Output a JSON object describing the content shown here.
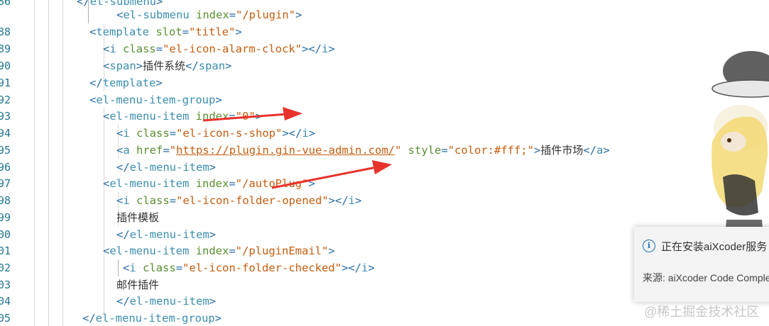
{
  "editor": {
    "line_numbers": [
      "86",
      "88",
      "89",
      "90",
      "91",
      "92",
      "93",
      "94",
      "95",
      "96",
      "97",
      "98",
      "99",
      "00",
      "01",
      "02",
      "03",
      "04",
      "05"
    ],
    "lines": {
      "l0": {
        "t1": "</",
        "t2": "el-submenu",
        "t3": ">"
      },
      "l1": {
        "t1": "<",
        "t2": "el-submenu",
        "a1": " index",
        "eq": "=",
        "v1": "\"/plugin\"",
        "t3": ">"
      },
      "l2": {
        "t1": "<",
        "t2": "template",
        "a1": " slot",
        "eq": "=",
        "v1": "\"title\"",
        "t3": ">"
      },
      "l3": {
        "t1": "<",
        "t2": "i",
        "a1": " class",
        "eq": "=",
        "v1": "\"el-icon-alarm-clock\"",
        "t3": "></",
        "t4": "i",
        "t5": ">"
      },
      "l4": {
        "t1": "<",
        "t2": "span",
        "t3": ">",
        "text": "插件系统",
        "t4": "</",
        "t5": "span",
        "t6": ">"
      },
      "l5": {
        "t1": "</",
        "t2": "template",
        "t3": ">"
      },
      "l6": {
        "t1": "<",
        "t2": "el-menu-item-group",
        "t3": ">"
      },
      "l7": {
        "t1": "<",
        "t2": "el-menu-item",
        "a1": " index",
        "eq": "=",
        "v1": "\"0\"",
        "t3": ">"
      },
      "l8": {
        "t1": "<",
        "t2": "i",
        "a1": " class",
        "eq": "=",
        "v1": "\"el-icon-s-shop\"",
        "t3": "></",
        "t4": "i",
        "t5": ">"
      },
      "l9": {
        "t1": "<",
        "t2": "a",
        "a1": " href",
        "eq": "=",
        "q1": "\"",
        "url": "https://plugin.gin-vue-admin.com/",
        "q2": "\"",
        "a2": " style",
        "eq2": "=",
        "v2": "\"color:#fff;\"",
        "t3": ">",
        "text": "插件市场",
        "t4": "</",
        "t5": "a",
        "t6": ">"
      },
      "l10": {
        "t1": "</",
        "t2": "el-menu-item",
        "t3": ">"
      },
      "l11": {
        "t1": "<",
        "t2": "el-menu-item",
        "a1": " index",
        "eq": "=",
        "v1": "\"/autoPlug\"",
        "t3": ">"
      },
      "l12": {
        "t1": "<",
        "t2": "i",
        "a1": " class",
        "eq": "=",
        "v1": "\"el-icon-folder-opened\"",
        "t3": "></",
        "t4": "i",
        "t5": ">"
      },
      "l13": {
        "text": "插件模板"
      },
      "l14": {
        "t1": "</",
        "t2": "el-menu-item",
        "t3": ">"
      },
      "l15": {
        "t1": "<",
        "t2": "el-menu-item",
        "a1": " index",
        "eq": "=",
        "v1": "\"/pluginEmail\"",
        "t3": ">"
      },
      "l16": {
        "t1": "<",
        "t2": "i",
        "a1": " class",
        "eq": "=",
        "v1": "\"el-icon-folder-checked\"",
        "t3": "></",
        "t4": "i",
        "t5": ">"
      },
      "l17": {
        "text": "邮件插件"
      },
      "l18": {
        "t1": "</",
        "t2": "el-menu-item",
        "t3": ">"
      },
      "l19": {
        "t1": "</",
        "t2": "el-menu-item-group",
        "t3": ">"
      }
    }
  },
  "notification": {
    "icon": "info-icon",
    "icon_glyph": "i",
    "message": "正在安装aiXcoder服务",
    "source": "来源: aiXcoder Code Completer"
  },
  "watermark": "@稀土掘金技术社区",
  "colors": {
    "line_number": "#237893",
    "tag": "#3b8eae",
    "attribute": "#5a8f2f",
    "string": "#c65d0e",
    "annotation_arrow": "#e8322c",
    "notification_bg": "#f3f3f3",
    "info_icon": "#1a73b8"
  }
}
